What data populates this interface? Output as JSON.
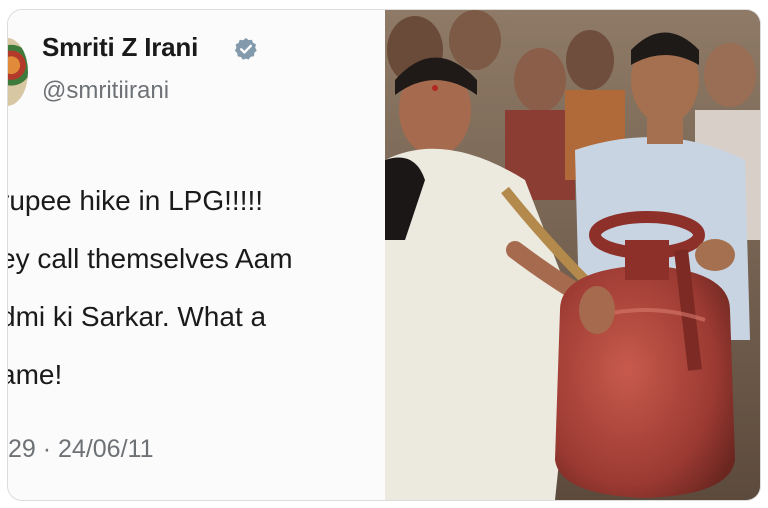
{
  "tweet": {
    "display_name": "Smriti Z Irani",
    "handle": "@smritiirani",
    "text_lines": [
      " rupee hike in LPG!!!!!",
      "ey call themselves Aam",
      "dmi ki Sarkar. What a",
      "ame!"
    ],
    "meta": "29 · 24/06/11"
  },
  "icons": {
    "verified": "verified-badge-icon",
    "avatar": "profile-avatar"
  },
  "colors": {
    "verified_badge": "#829aab",
    "text": "#1a1a1a",
    "secondary_text": "#6e7276",
    "cylinder": "#b2453b"
  }
}
